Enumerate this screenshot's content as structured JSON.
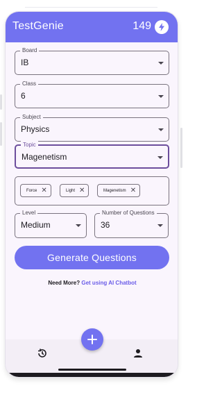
{
  "app": {
    "title": "TestGenie",
    "coins": "149"
  },
  "form": {
    "board": {
      "label": "Board",
      "value": "IB"
    },
    "class": {
      "label": "Class",
      "value": "6"
    },
    "subject": {
      "label": "Subject",
      "value": "Physics"
    },
    "topic": {
      "label": "Topic",
      "value": "Magenetism"
    },
    "subtopics": [
      "Force",
      "Light",
      "Magenetism"
    ],
    "level": {
      "label": "Level",
      "value": "Medium"
    },
    "num_questions": {
      "label": "Number of Questions",
      "value": "36"
    }
  },
  "generate_button": "Generate Questions",
  "need_more": {
    "text": "Need More?",
    "link": "Get using AI Chatbot"
  },
  "icons": {
    "bolt": "bolt-icon",
    "dropdown": "caret-down-icon",
    "remove_chip": "close-icon",
    "fab": "plus-icon",
    "history": "history-icon",
    "profile": "person-icon"
  },
  "colors": {
    "primary": "#7272f0",
    "focused_outline": "#6c4e9c",
    "background": "#faf5fd",
    "nav_background": "#f3eef6",
    "link": "#6a5ce8"
  }
}
